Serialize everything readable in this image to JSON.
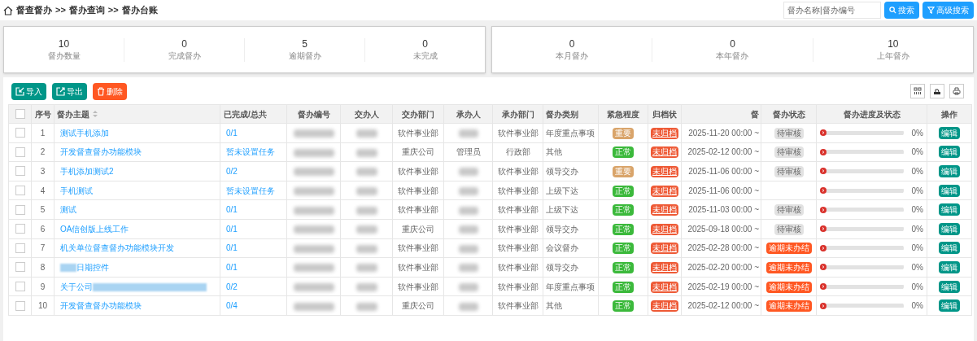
{
  "breadcrumb": [
    "督查督办",
    ">>",
    "督办查询",
    ">>",
    "督办台账"
  ],
  "search": {
    "placeholder": "督办名称|督办编号",
    "buttons": [
      "搜索",
      "高级搜索"
    ]
  },
  "stats_left": [
    {
      "value": "10",
      "label": "督办数量"
    },
    {
      "value": "0",
      "label": "完成督办"
    },
    {
      "value": "5",
      "label": "逾期督办"
    },
    {
      "value": "0",
      "label": "未完成"
    }
  ],
  "stats_right": [
    {
      "value": "0",
      "label": "本月督办"
    },
    {
      "value": "0",
      "label": "本年督办"
    },
    {
      "value": "10",
      "label": "上年督办"
    }
  ],
  "toolbar": [
    {
      "kind": "import",
      "label": "导入"
    },
    {
      "kind": "export",
      "label": "导出"
    },
    {
      "kind": "delete",
      "label": "删除"
    }
  ],
  "table": {
    "header_checkbox": {
      "checked": false
    },
    "columns": [
      "序号",
      "督办主题",
      "已完成/总共",
      "督办编号",
      "交办人",
      "交办部门",
      "承办人",
      "承办部门",
      "督办类别",
      "紧急程度",
      "归档状",
      "督",
      "督办状态",
      "督办进度及状态",
      "操作"
    ],
    "rows": [
      {
        "no": "1",
        "subject": "测试手机添加",
        "done": "0/1",
        "assign_dept": "软件事业部",
        "handler": "",
        "handle_dept": "软件事业部",
        "category": "年度重点事项",
        "urgency": {
          "kind": "important",
          "label": "重要"
        },
        "archive": "未归档",
        "time": "2025-11-20 00:00 ~",
        "status": {
          "kind": "pending",
          "label": "待审核"
        },
        "level": 0,
        "percent": "0%",
        "action": "编辑",
        "checked": false
      },
      {
        "no": "2",
        "subject": "开发督查督办功能模块",
        "done": "暂未设置任务",
        "assign_dept": "重庆公司",
        "handler": "管理员",
        "handle_dept": "行政部",
        "category": "其他",
        "urgency": {
          "kind": "normal",
          "label": "正常"
        },
        "archive": "未归档",
        "time": "2025-02-12 00:00 ~",
        "status": {
          "kind": "pending",
          "label": "待审核"
        },
        "level": 0,
        "percent": "0%",
        "action": "编辑",
        "checked": false
      },
      {
        "no": "3",
        "subject": "手机添加测试2",
        "done": "0/2",
        "assign_dept": "软件事业部",
        "handler": "",
        "handle_dept": "软件事业部",
        "category": "领导交办",
        "urgency": {
          "kind": "important",
          "label": "重要"
        },
        "archive": "未归档",
        "time": "2025-11-06 00:00 ~",
        "status": {
          "kind": "pending",
          "label": "待审核"
        },
        "level": 0,
        "percent": "0%",
        "action": "编辑",
        "checked": false
      },
      {
        "no": "4",
        "subject": "手机测试",
        "done": "暂未设置任务",
        "assign_dept": "软件事业部",
        "handler": "",
        "handle_dept": "软件事业部",
        "category": "上级下达",
        "urgency": {
          "kind": "normal",
          "label": "正常"
        },
        "archive": "未归档",
        "time": "2025-11-06 00:00 ~",
        "status": {
          "kind": "none"
        },
        "level": 0,
        "percent": "0%",
        "action": "编辑",
        "checked": false
      },
      {
        "no": "5",
        "subject": "测试",
        "done": "0/1",
        "assign_dept": "软件事业部",
        "handler": "",
        "handle_dept": "软件事业部",
        "category": "上级下达",
        "urgency": {
          "kind": "normal",
          "label": "正常"
        },
        "archive": "未归档",
        "time": "2025-11-03 00:00 ~",
        "status": {
          "kind": "pending",
          "label": "待审核"
        },
        "level": 0,
        "percent": "0%",
        "action": "编辑",
        "checked": false
      },
      {
        "no": "6",
        "subject": "OA信创版上线工作",
        "done": "0/1",
        "assign_dept": "重庆公司",
        "handler": "",
        "handle_dept": "软件事业部",
        "category": "领导交办",
        "urgency": {
          "kind": "normal",
          "label": "正常"
        },
        "archive": "未归档",
        "time": "2025-09-18 00:00 ~",
        "status": {
          "kind": "pending",
          "label": "待审核"
        },
        "level": 0,
        "percent": "0%",
        "action": "编辑",
        "checked": false
      },
      {
        "no": "7",
        "subject": "机关单位督查督办功能模块开发",
        "done": "0/1",
        "assign_dept": "软件事业部",
        "handler": "",
        "handle_dept": "软件事业部",
        "category": "会议督办",
        "urgency": {
          "kind": "normal",
          "label": "正常"
        },
        "archive": "未归档",
        "time": "2025-02-28 00:00 ~",
        "status": {
          "kind": "overdue",
          "label": "逾期未办结"
        },
        "level": 0,
        "percent": "0%",
        "action": "编辑",
        "checked": false
      },
      {
        "no": "8",
        "subject": "日期控件",
        "kind": "blur_prefix",
        "done": "0/1",
        "assign_dept": "软件事业部",
        "handler": "",
        "handle_dept": "软件事业部",
        "category": "领导交办",
        "urgency": {
          "kind": "normal",
          "label": "正常"
        },
        "archive": "未归档",
        "time": "2025-02-20 00:00 ~",
        "status": {
          "kind": "overdue",
          "label": "逾期未办结"
        },
        "level": 0,
        "percent": "0%",
        "action": "编辑",
        "checked": false
      },
      {
        "no": "9",
        "subject": "关于公司",
        "kind": "blur_suffix",
        "done": "0/2",
        "assign_dept": "软件事业部",
        "handler": "",
        "handle_dept": "软件事业部",
        "category": "年度重点事项",
        "urgency": {
          "kind": "normal",
          "label": "正常"
        },
        "archive": "未归档",
        "time": "2025-02-19 00:00 ~",
        "status": {
          "kind": "overdue",
          "label": "逾期未办结"
        },
        "level": 0,
        "percent": "0%",
        "action": "编辑",
        "checked": false
      },
      {
        "no": "10",
        "subject": "开发督查督办功能模块",
        "done": "0/4",
        "assign_dept": "重庆公司",
        "handler": "",
        "handle_dept": "软件事业部",
        "category": "其他",
        "urgency": {
          "kind": "normal",
          "label": "正常"
        },
        "archive": "未归档",
        "time": "2025-02-12 00:00 ~",
        "status": {
          "kind": "overdue",
          "label": "逾期未办结"
        },
        "level": 0,
        "percent": "0%",
        "action": "编辑",
        "checked": false
      }
    ]
  }
}
